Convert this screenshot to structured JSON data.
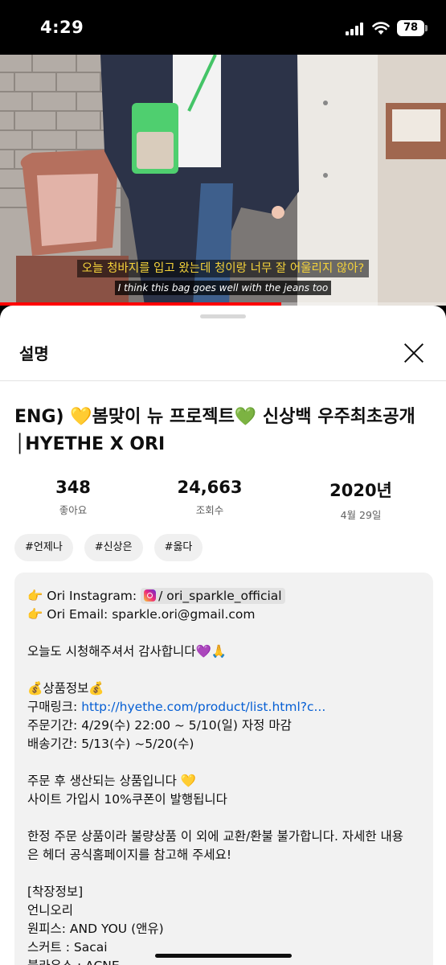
{
  "status": {
    "time": "4:29",
    "battery": "78"
  },
  "video": {
    "subtitle_ko": "오늘 청바지를 입고 왔는데 청이랑 너무 잘 어울리지 않아?",
    "subtitle_en": "I think this bag goes well with the jeans too",
    "progress_fraction": 0.63
  },
  "sheet": {
    "title": "설명",
    "video_title": "ENG) 💛봄맞이 뉴 프로젝트💚 신상백 우주최초공개│HYETHE X ORI",
    "stats": [
      {
        "value": "348",
        "label": "좋아요"
      },
      {
        "value": "24,663",
        "label": "조회수"
      },
      {
        "value": "2020년",
        "label": "4월 29일"
      }
    ],
    "hashtags": [
      "#언제나",
      "#신상은",
      "#옳다"
    ]
  },
  "description": {
    "instagram_label": "Ori Instagram:",
    "instagram_handle": "/ ori_sparkle_official",
    "email_line": "Ori Email: sparkle.ori@gmail.com",
    "thanks": "오늘도 시청해주셔서 감사합니다",
    "product_heading": "상품정보",
    "buy_link_label": "구매링크:",
    "buy_link": "http://hyethe.com/product/list.html?c...",
    "order_period": "주문기간: 4/29(수) 22:00 ~ 5/10(일) 자정 마감",
    "ship_period": "배송기간: 5/13(수) ~5/20(수)",
    "made_to_order": "주문 후 생산되는 상품입니다",
    "coupon": "사이트 가입시 10%쿠폰이 발행됩니다",
    "policy_1": "한정 주문 상품이라 불량상품 이 외에 교환/환불 불가합니다. 자세한 내용",
    "policy_2": "은 헤더 공식홈페이지를 참고해 주세요!",
    "outfit_heading": "[착장정보]",
    "outfit_person": "언니오리",
    "outfit_dress": "원피스: AND YOU (앤유)",
    "outfit_skirt": "스커트 : Sacai",
    "outfit_blouse": "블라우스 : ACNE"
  },
  "colors": {
    "accent": "#ff0000",
    "link": "#065fd4",
    "subtitle_yellow": "#f5d33a"
  }
}
